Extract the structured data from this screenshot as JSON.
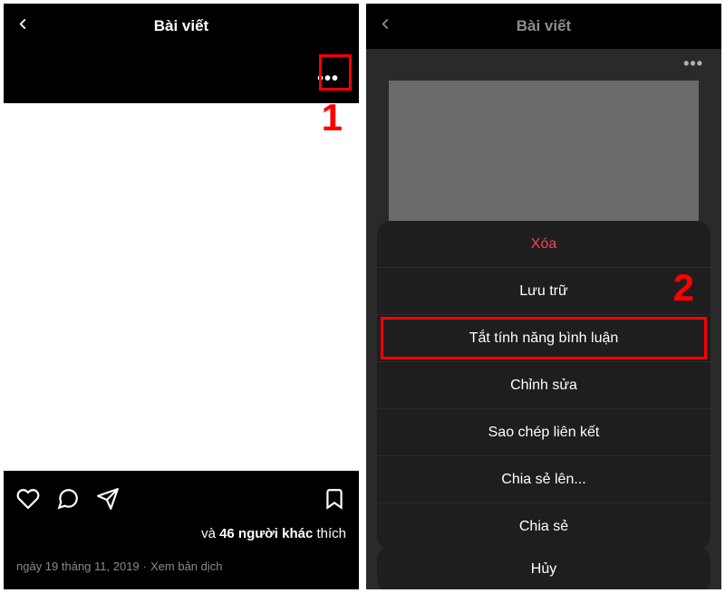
{
  "left": {
    "header_title": "Bài viết",
    "likes_prefix": "và ",
    "likes_bold": "46 người khác",
    "likes_suffix": " thích",
    "date": "ngày 19 tháng 11, 2019",
    "translate": "Xem bản dịch"
  },
  "right": {
    "header_title": "Bài viết",
    "sheet": {
      "delete": "Xóa",
      "archive": "Lưu trữ",
      "disable_comments": "Tắt tính năng bình luận",
      "edit": "Chỉnh sửa",
      "copy_link": "Sao chép liên kết",
      "share_to": "Chia sẻ lên...",
      "share": "Chia sẻ",
      "cancel": "Hủy"
    }
  },
  "annotations": {
    "one": "1",
    "two": "2"
  }
}
